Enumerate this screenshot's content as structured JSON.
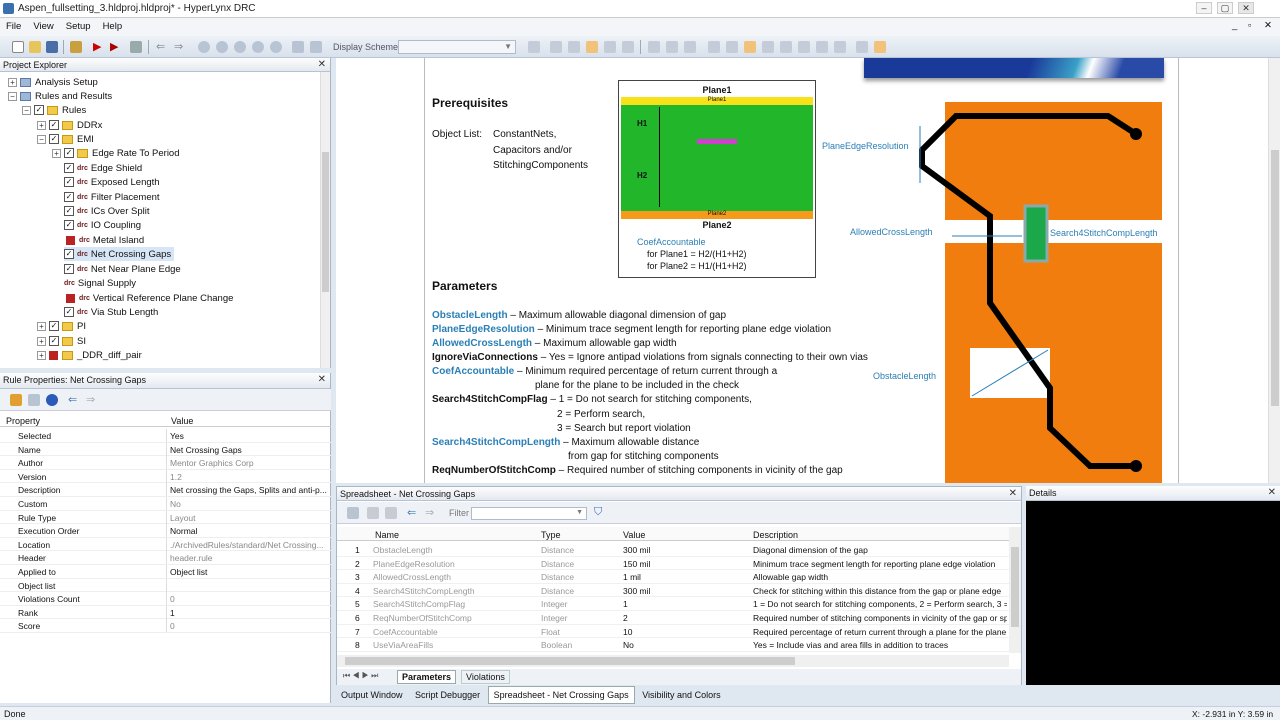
{
  "window": {
    "title": "Aspen_fullsetting_3.hldproj.hldproj* - HyperLynx DRC",
    "min": "–",
    "max": "▢",
    "close": "✕",
    "sys_min": "_",
    "sys_restore": "▫",
    "sys_close": "✕"
  },
  "menu": [
    "File",
    "View",
    "Setup",
    "Help"
  ],
  "toolbar": {
    "display_scheme_label": "Display Scheme"
  },
  "explorer": {
    "title": "Project Explorer",
    "close": "✕",
    "rows": [
      {
        "label": "Analysis Setup"
      },
      {
        "label": "Rules and Results"
      },
      {
        "label": "Rules"
      },
      {
        "label": "DDRx"
      },
      {
        "label": "EMI"
      },
      {
        "label": "Edge Rate To Period"
      },
      {
        "label": "Edge Shield"
      },
      {
        "label": "Exposed Length"
      },
      {
        "label": "Filter Placement"
      },
      {
        "label": "ICs Over Split"
      },
      {
        "label": "IO Coupling"
      },
      {
        "label": "Metal Island"
      },
      {
        "label": "Net Crossing Gaps"
      },
      {
        "label": "Net Near Plane Edge"
      },
      {
        "label": "Signal Supply"
      },
      {
        "label": "Vertical Reference Plane Change"
      },
      {
        "label": "Via Stub Length"
      },
      {
        "label": "PI"
      },
      {
        "label": "SI"
      },
      {
        "label": "_DDR_diff_pair"
      }
    ]
  },
  "props": {
    "title": "Rule Properties: Net Crossing Gaps",
    "close": "✕",
    "col_property": "Property",
    "col_value": "Value",
    "rows": [
      {
        "k": "Selected",
        "v": "Yes"
      },
      {
        "k": "Name",
        "v": "Net Crossing Gaps"
      },
      {
        "k": "Author",
        "v": "Mentor Graphics Corp"
      },
      {
        "k": "Version",
        "v": "1.2"
      },
      {
        "k": "Description",
        "v": "Net crossing the Gaps, Splits and anti-p..."
      },
      {
        "k": "Custom",
        "v": "No"
      },
      {
        "k": "Rule Type",
        "v": "Layout"
      },
      {
        "k": "Execution Order",
        "v": "Normal"
      },
      {
        "k": "Location",
        "v": "./ArchivedRules/standard/Net Crossing..."
      },
      {
        "k": "Header",
        "v": "header.rule"
      },
      {
        "k": "Applied to",
        "v": "Object list"
      },
      {
        "k": "Object list",
        "v": ""
      },
      {
        "k": "Violations Count",
        "v": "0"
      },
      {
        "k": "Rank",
        "v": "1"
      },
      {
        "k": "Score",
        "v": "0"
      }
    ]
  },
  "doc": {
    "prereq_title": "Prerequisites",
    "object_list_label": "Object List:",
    "object_list_items": [
      "ConstantNets,",
      "Capacitors and/or",
      "StitchingComponents"
    ],
    "params_title": "Parameters",
    "fig1": {
      "plane1": "Plane1",
      "plane1_small": "Plane1",
      "plane2": "Plane2",
      "plane2_small": "Plane2",
      "h1": "H1",
      "h2": "H2",
      "coef": "CoefAccountable",
      "line1": "for Plane1 = H2/(H1+H2)",
      "line2": "for Plane2 = H1/(H1+H2)"
    },
    "fig2": {
      "edge": "PlaneEdgeResolution",
      "cross": "AllowedCrossLength",
      "stitch": "Search4StitchCompLength",
      "obstacle": "ObstacleLength"
    },
    "params": [
      {
        "name": "ObstacleLength",
        "desc": " – Maximum allowable diagonal dimension of gap",
        "blue": true
      },
      {
        "name": "PlaneEdgeResolution",
        "desc": " – Minimum trace segment length for reporting plane edge violation",
        "blue": true
      },
      {
        "name": "AllowedCrossLength",
        "desc": " – Maximum allowable gap width",
        "blue": true
      },
      {
        "name": "IgnoreViaConnections",
        "desc": " – Yes = Ignore antipad violations from signals connecting to their own vias",
        "blue": false
      },
      {
        "name": "CoefAccountable",
        "desc": " – Minimum required percentage of return current through a",
        "blue": true
      },
      {
        "name": "",
        "desc": "plane for the plane to be included in the check",
        "blue": false
      },
      {
        "name": "Search4StitchCompFlag",
        "desc": " – 1 = Do not search for stitching components,",
        "blue": false
      },
      {
        "name": "",
        "desc": "2 = Perform search,",
        "blue": false
      },
      {
        "name": "",
        "desc": "3 = Search but report violation",
        "blue": false
      },
      {
        "name": "Search4StitchCompLength",
        "desc": " – Maximum allowable distance",
        "blue": true
      },
      {
        "name": "",
        "desc": "from gap for stitching components",
        "blue": false
      },
      {
        "name": "ReqNumberOfStitchComp",
        "desc": " – Required number of stitching components in vicinity of the gap",
        "blue": false
      }
    ]
  },
  "spread": {
    "title": "Spreadsheet - Net Crossing Gaps",
    "close": "✕",
    "filter": "Filter",
    "cols": [
      "Name",
      "Type",
      "Value",
      "Description"
    ],
    "rows": [
      [
        "1",
        "ObstacleLength",
        "Distance",
        "300 mil",
        "Diagonal dimension of the gap"
      ],
      [
        "2",
        "PlaneEdgeResolution",
        "Distance",
        "150 mil",
        "Minimum trace segment length for reporting plane edge violation"
      ],
      [
        "3",
        "AllowedCrossLength",
        "Distance",
        "1 mil",
        "Allowable gap width"
      ],
      [
        "4",
        "Search4StitchCompLength",
        "Distance",
        "300 mil",
        "Check for stitching within this distance from the gap or plane edge"
      ],
      [
        "5",
        "Search4StitchCompFlag",
        "Integer",
        "1",
        "1 = Do not search for stitching components, 2 = Perform search, 3 ="
      ],
      [
        "6",
        "ReqNumberOfStitchComp",
        "Integer",
        "2",
        "Required number of stitching components in vicinity of the gap or sp"
      ],
      [
        "7",
        "CoefAccountable",
        "Float",
        "10",
        "Required percentage of return current through a plane for the plane"
      ],
      [
        "8",
        "UseViaAreaFills",
        "Boolean",
        "No",
        "Yes = Include vias and area fills in addition to traces"
      ]
    ],
    "tabs": [
      "Parameters",
      "Violations"
    ]
  },
  "details": {
    "title": "Details",
    "close": "✕"
  },
  "bottom_tabs": [
    "Output Window",
    "Script Debugger",
    "Spreadsheet - Net Crossing Gaps",
    "Visibility and Colors"
  ],
  "status": {
    "left": "Done",
    "right": "X: -2.931 in Y: 3.59 in"
  }
}
